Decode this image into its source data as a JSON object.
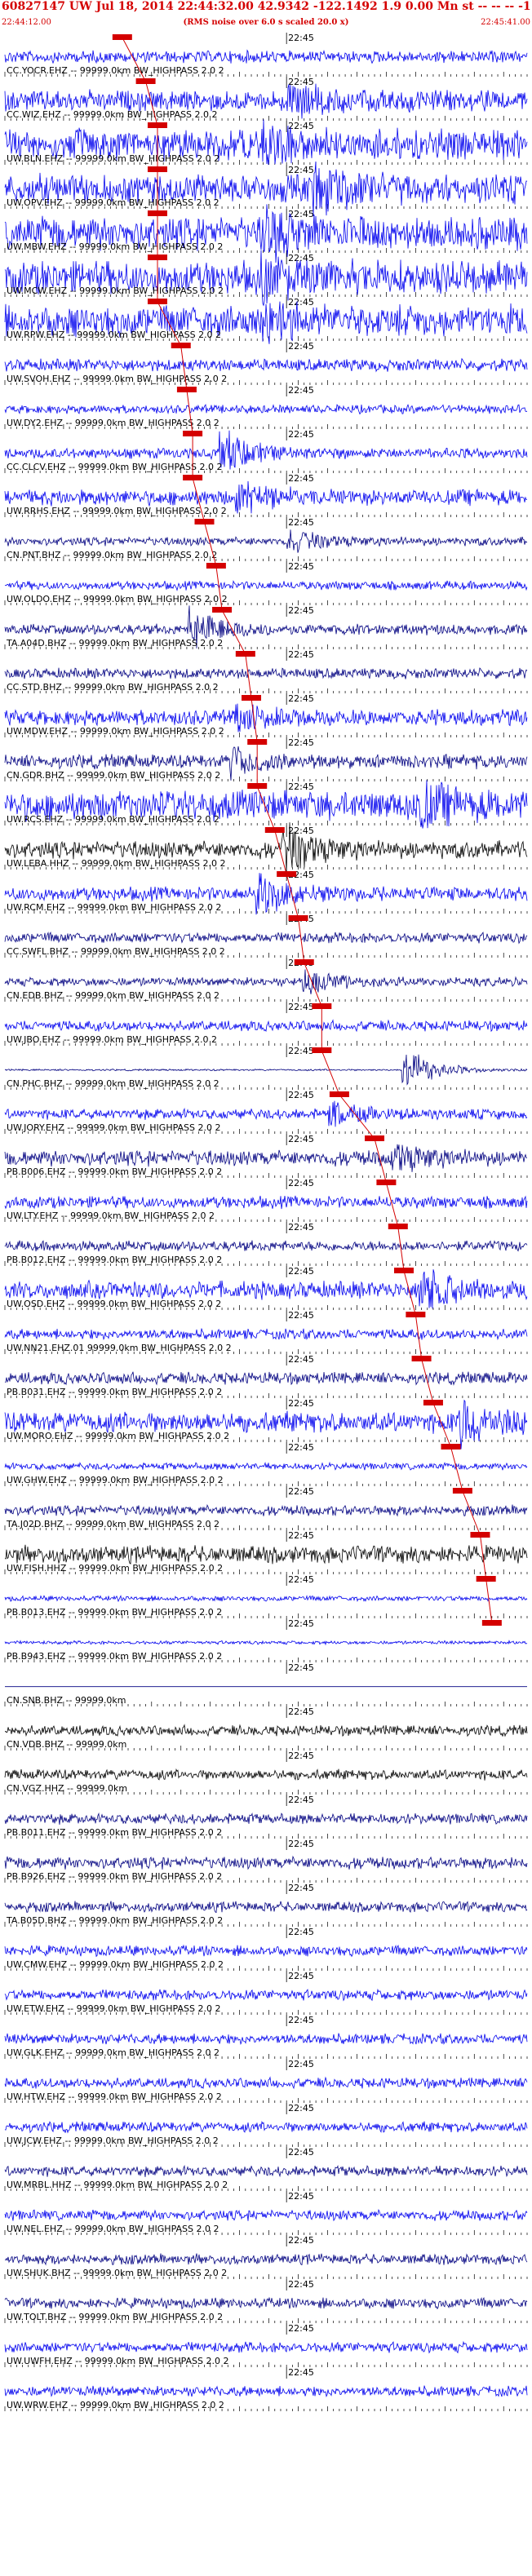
{
  "header": {
    "title": "60827147 UW Jul 18, 2014 22:44:32.00   42.9342 -122.1492  1.9 0.00 Mn st -- -- -- -1",
    "subtitle": "(RMS noise over 6.0 s scaled 20.0 x)",
    "time_start": "22:44:12.00",
    "time_end": "22:45:41.00",
    "mid_tick_label": "22:45",
    "colors": {
      "header": "#d40000",
      "pick": "#d40000",
      "trace_blue": "#0000ee",
      "trace_navy": "#000080",
      "trace_black": "#000000",
      "grid": "#000000"
    }
  },
  "chart_data": {
    "type": "line",
    "title": "60827147 UW Jul 18, 2014 22:44:32.00   42.9342 -122.1492  1.9 0.00 Mn st -- -- -- -1",
    "x_range": [
      "22:44:12.00",
      "22:45:41.00"
    ],
    "series": [
      {
        "name": "CC.YOCR.EHZ -- 99999.0km BW_HIGHPASS  2.0  2",
        "color": "blue",
        "amp": 0.35,
        "pick": "22:44:32",
        "burst_at": null,
        "burst_amp": 0
      },
      {
        "name": "CC.WIZ.EHZ -- 99999.0km BW_HIGHPASS  2.0  2",
        "color": "blue",
        "amp": 0.6,
        "pick": "22:44:36",
        "burst_at": 0.55,
        "burst_amp": 0.7
      },
      {
        "name": "UW.BLN.EHZ -- 99999.0km BW_HIGHPASS  2.0  2",
        "color": "blue",
        "amp": 0.9,
        "pick": "22:44:38",
        "burst_at": 0.5,
        "burst_amp": 0.8
      },
      {
        "name": "UW.OPV.EHZ -- 99999.0km BW_HIGHPASS  2.0  2",
        "color": "blue",
        "amp": 0.85,
        "pick": "22:44:38",
        "burst_at": 0.6,
        "burst_amp": 0.7
      },
      {
        "name": "UW.MBW.EHZ -- 99999.0km BW_HIGHPASS  2.0  2",
        "color": "blue",
        "amp": 0.95,
        "pick": "22:44:38",
        "burst_at": 0.5,
        "burst_amp": 0.8
      },
      {
        "name": "UW.MCW.EHZ -- 99999.0km BW_HIGHPASS  2.0  2",
        "color": "blue",
        "amp": 0.95,
        "pick": "22:44:38",
        "burst_at": 0.5,
        "burst_amp": 0.8
      },
      {
        "name": "UW.RPW.EHZ -- 99999.0km BW_HIGHPASS  2.0  2",
        "color": "blue",
        "amp": 0.9,
        "pick": "22:44:38",
        "burst_at": 0.5,
        "burst_amp": 0.7
      },
      {
        "name": "UW.SVOH.EHZ -- 99999.0km BW_HIGHPASS  2.0  2",
        "color": "blue",
        "amp": 0.35,
        "pick": "22:44:42",
        "burst_at": null,
        "burst_amp": 0
      },
      {
        "name": "UW.DY2.EHZ -- 99999.0km BW_HIGHPASS  2.0  2",
        "color": "blue",
        "amp": 0.25,
        "pick": "22:44:43",
        "burst_at": null,
        "burst_amp": 0
      },
      {
        "name": "CC.CLCV.EHZ -- 99999.0km BW_HIGHPASS  2.0  2",
        "color": "blue",
        "amp": 0.3,
        "pick": "22:44:44",
        "burst_at": 0.42,
        "burst_amp": 0.9
      },
      {
        "name": "UW.RRHS.EHZ -- 99999.0km BW_HIGHPASS  2.0  2",
        "color": "blue",
        "amp": 0.45,
        "pick": "22:44:44",
        "burst_at": 0.45,
        "burst_amp": 0.6
      },
      {
        "name": "CN.PNT.BHZ -- 99999.0km BW_HIGHPASS  2.0  2",
        "color": "navy",
        "amp": 0.25,
        "pick": "22:44:46",
        "burst_at": 0.55,
        "burst_amp": 0.5
      },
      {
        "name": "UW.OLDO.EHZ -- 99999.0km BW_HIGHPASS  2.0  2",
        "color": "blue",
        "amp": 0.25,
        "pick": "22:44:48",
        "burst_at": null,
        "burst_amp": 0
      },
      {
        "name": "TA.A04D.BHZ -- 99999.0km BW_HIGHPASS  2.0  2",
        "color": "navy",
        "amp": 0.3,
        "pick": "22:44:49",
        "burst_at": 0.36,
        "burst_amp": 0.9
      },
      {
        "name": "CC.STD.BHZ -- 99999.0km BW_HIGHPASS  2.0  2",
        "color": "navy",
        "amp": 0.3,
        "pick": "22:44:53",
        "burst_at": null,
        "burst_amp": 0
      },
      {
        "name": "UW.MDW.EHZ -- 99999.0km BW_HIGHPASS  2.0  2",
        "color": "blue",
        "amp": 0.45,
        "pick": "22:44:54",
        "burst_at": 0.45,
        "burst_amp": 0.5
      },
      {
        "name": "CN.GDR.BHZ -- 99999.0km BW_HIGHPASS  2.0  2",
        "color": "navy",
        "amp": 0.4,
        "pick": "22:44:55",
        "burst_at": 0.44,
        "burst_amp": 0.6
      },
      {
        "name": "UW.RCS.EHZ -- 99999.0km BW_HIGHPASS  2.0  2",
        "color": "blue",
        "amp": 0.85,
        "pick": "22:44:55",
        "burst_at": 0.8,
        "burst_amp": 0.8
      },
      {
        "name": "UW.LEBA.HHZ -- 99999.0km BW_HIGHPASS  2.0  2",
        "color": "black",
        "amp": 0.5,
        "pick": "22:44:58",
        "burst_at": 0.54,
        "burst_amp": 1.0
      },
      {
        "name": "UW.RCM.EHZ -- 99999.0km BW_HIGHPASS  2.0  2",
        "color": "blue",
        "amp": 0.4,
        "pick": "22:45:00",
        "burst_at": 0.49,
        "burst_amp": 0.9
      },
      {
        "name": "CC.SWFL.BHZ -- 99999.0km BW_HIGHPASS  2.0  2",
        "color": "navy",
        "amp": 0.3,
        "pick": "22:45:02",
        "burst_at": null,
        "burst_amp": 0
      },
      {
        "name": "CN.EDB.BHZ -- 99999.0km BW_HIGHPASS  2.0  2",
        "color": "navy",
        "amp": 0.25,
        "pick": "22:45:03",
        "burst_at": 0.58,
        "burst_amp": 0.5
      },
      {
        "name": "UW.JBO.EHZ -- 99999.0km BW_HIGHPASS  2.0  2",
        "color": "blue",
        "amp": 0.3,
        "pick": "22:45:06",
        "burst_at": null,
        "burst_amp": 0
      },
      {
        "name": "CN.PHC.BHZ -- 99999.0km BW_HIGHPASS  2.0  2",
        "color": "navy",
        "amp": 0.05,
        "pick": "22:45:06",
        "burst_at": 0.77,
        "burst_amp": 1.0
      },
      {
        "name": "UW.JORY.EHZ -- 99999.0km BW_HIGHPASS  2.0  2",
        "color": "blue",
        "amp": 0.3,
        "pick": "22:45:09",
        "burst_at": 0.63,
        "burst_amp": 0.5
      },
      {
        "name": "PB.B006.EHZ -- 99999.0km BW_HIGHPASS  2.0  2",
        "color": "navy",
        "amp": 0.45,
        "pick": "22:45:15",
        "burst_at": 0.75,
        "burst_amp": 0.6
      },
      {
        "name": "UW.LTY.EHZ -- 99999.0km BW_HIGHPASS  2.0  2",
        "color": "blue",
        "amp": 0.35,
        "pick": "22:45:17",
        "burst_at": null,
        "burst_amp": 0
      },
      {
        "name": "PB.B012.EHZ -- 99999.0km BW_HIGHPASS  2.0  2",
        "color": "navy",
        "amp": 0.3,
        "pick": "22:45:19",
        "burst_at": null,
        "burst_amp": 0
      },
      {
        "name": "UW.OSD.EHZ -- 99999.0km BW_HIGHPASS  2.0  2",
        "color": "blue",
        "amp": 0.5,
        "pick": "22:45:20",
        "burst_at": 0.8,
        "burst_amp": 1.0
      },
      {
        "name": "UW.NN21.EHZ.01 99999.0km BW_HIGHPASS  2.0  2",
        "color": "blue",
        "amp": 0.3,
        "pick": "22:45:22",
        "burst_at": null,
        "burst_amp": 0
      },
      {
        "name": "PB.B031.EHZ -- 99999.0km BW_HIGHPASS  2.0  2",
        "color": "navy",
        "amp": 0.35,
        "pick": "22:45:23",
        "burst_at": null,
        "burst_amp": 0
      },
      {
        "name": "UW.MORO.EHZ -- 99999.0km BW_HIGHPASS  2.0  2",
        "color": "blue",
        "amp": 0.6,
        "pick": "22:45:25",
        "burst_at": 0.88,
        "burst_amp": 1.0
      },
      {
        "name": "UW.GHW.EHZ -- 99999.0km BW_HIGHPASS  2.0  2",
        "color": "blue",
        "amp": 0.2,
        "pick": "22:45:28",
        "burst_at": null,
        "burst_amp": 0
      },
      {
        "name": "TA.J02D.BHZ -- 99999.0km BW_HIGHPASS  2.0  2",
        "color": "navy",
        "amp": 0.3,
        "pick": "22:45:30",
        "burst_at": null,
        "burst_amp": 0
      },
      {
        "name": "UW.FISH.HHZ -- 99999.0km BW_HIGHPASS  2.0  2",
        "color": "black",
        "amp": 0.5,
        "pick": "22:45:33",
        "burst_at": null,
        "burst_amp": 0
      },
      {
        "name": "PB.B013.EHZ -- 99999.0km BW_HIGHPASS  2.0  2",
        "color": "blue",
        "amp": 0.15,
        "pick": "22:45:34",
        "burst_at": null,
        "burst_amp": 0
      },
      {
        "name": "PB.B943.EHZ -- 99999.0km BW_HIGHPASS  2.0  2",
        "color": "blue",
        "amp": 0.1,
        "pick": "22:45:35",
        "burst_at": null,
        "burst_amp": 0
      },
      {
        "name": "CN.SNB.BHZ -- 99999.0km",
        "color": "navy",
        "amp": 0.0,
        "pick": null,
        "burst_at": null,
        "burst_amp": 0
      },
      {
        "name": "CN.VDB.BHZ -- 99999.0km",
        "color": "black",
        "amp": 0.3,
        "pick": null,
        "burst_at": null,
        "burst_amp": 0
      },
      {
        "name": "CN.VGZ.HHZ -- 99999.0km",
        "color": "black",
        "amp": 0.3,
        "pick": null,
        "burst_at": null,
        "burst_amp": 0
      },
      {
        "name": "PB.B011.EHZ -- 99999.0km BW_HIGHPASS  2.0  2",
        "color": "navy",
        "amp": 0.3,
        "pick": null,
        "burst_at": null,
        "burst_amp": 0
      },
      {
        "name": "PB.B926.EHZ -- 99999.0km BW_HIGHPASS  2.0  2",
        "color": "navy",
        "amp": 0.35,
        "pick": null,
        "burst_at": null,
        "burst_amp": 0
      },
      {
        "name": "TA.B05D.BHZ -- 99999.0km BW_HIGHPASS  2.0  2",
        "color": "navy",
        "amp": 0.3,
        "pick": null,
        "burst_at": null,
        "burst_amp": 0
      },
      {
        "name": "UW.CMW.EHZ -- 99999.0km BW_HIGHPASS  2.0  2",
        "color": "blue",
        "amp": 0.3,
        "pick": null,
        "burst_at": null,
        "burst_amp": 0
      },
      {
        "name": "UW.ETW.EHZ -- 99999.0km BW_HIGHPASS  2.0  2",
        "color": "blue",
        "amp": 0.3,
        "pick": null,
        "burst_at": null,
        "burst_amp": 0
      },
      {
        "name": "UW.GLK.EHZ -- 99999.0km BW_HIGHPASS  2.0  2",
        "color": "blue",
        "amp": 0.3,
        "pick": null,
        "burst_at": null,
        "burst_amp": 0
      },
      {
        "name": "UW.HTW.EHZ -- 99999.0km BW_HIGHPASS  2.0  2",
        "color": "blue",
        "amp": 0.3,
        "pick": null,
        "burst_at": null,
        "burst_amp": 0
      },
      {
        "name": "UW.JCW.EHZ -- 99999.0km BW_HIGHPASS  2.0  2",
        "color": "blue",
        "amp": 0.3,
        "pick": null,
        "burst_at": null,
        "burst_amp": 0
      },
      {
        "name": "UW.MRBL.HHZ -- 99999.0km BW_HIGHPASS  2.0  2",
        "color": "navy",
        "amp": 0.3,
        "pick": null,
        "burst_at": null,
        "burst_amp": 0
      },
      {
        "name": "UW.NEL.EHZ -- 99999.0km BW_HIGHPASS  2.0  2",
        "color": "blue",
        "amp": 0.3,
        "pick": null,
        "burst_at": null,
        "burst_amp": 0
      },
      {
        "name": "UW.SHUK.BHZ -- 99999.0km BW_HIGHPASS  2.0  2",
        "color": "navy",
        "amp": 0.3,
        "pick": null,
        "burst_at": null,
        "burst_amp": 0
      },
      {
        "name": "UW.TOLT.BHZ -- 99999.0km BW_HIGHPASS  2.0  2",
        "color": "navy",
        "amp": 0.3,
        "pick": null,
        "burst_at": null,
        "burst_amp": 0
      },
      {
        "name": "UW.UWFH.EHZ -- 99999.0km BW_HIGHPASS  2.0  2",
        "color": "blue",
        "amp": 0.3,
        "pick": null,
        "burst_at": null,
        "burst_amp": 0
      },
      {
        "name": "UW.WRW.EHZ -- 99999.0km BW_HIGHPASS  2.0  2",
        "color": "blue",
        "amp": 0.3,
        "pick": null,
        "burst_at": null,
        "burst_amp": 0
      }
    ]
  }
}
